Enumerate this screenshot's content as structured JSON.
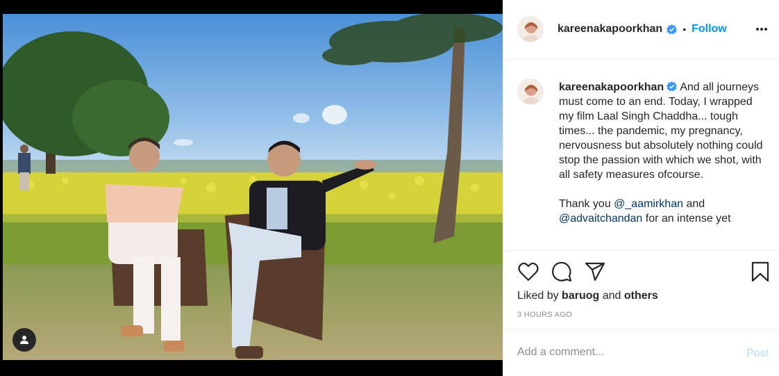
{
  "post": {
    "username": "kareenakapoorkhan",
    "separator": "•",
    "follow_label": "Follow",
    "more_icon": "more-options-icon"
  },
  "caption": {
    "username": "kareenakapoorkhan",
    "text_part1": "And all journeys must come to an end. Today, I wrapped my film Laal Singh Chaddha... tough times... the pandemic, my pregnancy, nervousness but absolutely nothing could stop the passion with which we shot, with all safety measures ofcourse.",
    "text_part2_prefix": "Thank you ",
    "mention1": "@_aamirkhan",
    "text_part2_mid": " and ",
    "mention2": "@advaitchandan",
    "text_part2_suffix": " for an intense yet"
  },
  "actions": {
    "liked_prefix": "Liked by ",
    "liked_user": "baruog",
    "liked_mid": " and ",
    "liked_others": "others",
    "timestamp": "3 HOURS AGO",
    "icons": [
      "heart-icon",
      "comment-icon",
      "share-icon",
      "bookmark-icon"
    ]
  },
  "comment_box": {
    "placeholder": "Add a comment...",
    "post_label": "Post"
  },
  "colors": {
    "accent": "#0095f6",
    "post_disabled": "#b2dffc",
    "verified": "#3897f0",
    "mention": "#00376b"
  }
}
